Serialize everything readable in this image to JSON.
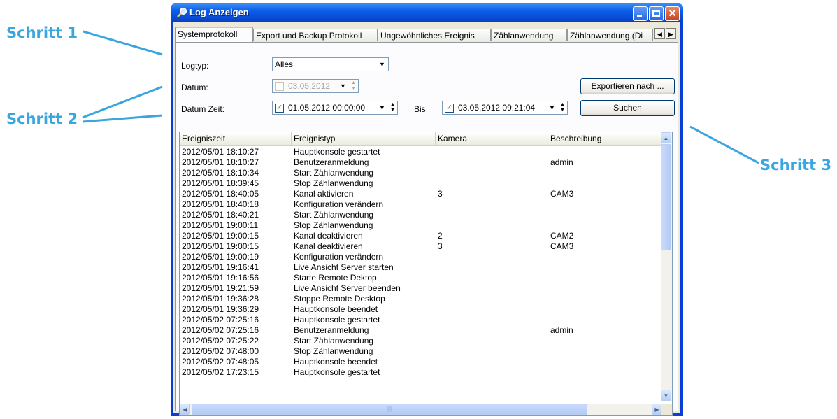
{
  "annotations": {
    "step1": "Schritt 1",
    "step2": "Schritt 2",
    "step3": "Schritt 3",
    "color": "#3aa6e0"
  },
  "window": {
    "title": "Log Anzeigen",
    "icon": "magnifier-icon",
    "close_glyph": "✕"
  },
  "tabs": [
    {
      "label": "Systemprotokoll",
      "active": true
    },
    {
      "label": "Export und Backup Protokoll",
      "active": false
    },
    {
      "label": "Ungewöhnliches Ereignis",
      "active": false
    },
    {
      "label": "Zählanwendung",
      "active": false
    },
    {
      "label": "Zählanwendung (Di",
      "active": false
    }
  ],
  "tab_scroll": {
    "left": "◀",
    "right": "▶"
  },
  "form": {
    "logtyp_label": "Logtyp:",
    "logtyp_value": "Alles",
    "datum_label": "Datum:",
    "datum_value": "03.05.2012",
    "datumzeit_label": "Datum Zeit:",
    "from_value": "01.05.2012 00:00:00",
    "bis_label": "Bis",
    "to_value": "03.05.2012 09:21:04",
    "export_button": "Exportieren nach ...",
    "search_button": "Suchen",
    "check_glyph": "✓",
    "dropdown_glyph": "▼",
    "spin_up": "▲",
    "spin_down": "▼"
  },
  "table": {
    "columns": [
      "Ereigniszeit",
      "Ereignistyp",
      "Kamera",
      "Beschreibung"
    ],
    "rows": [
      [
        "2012/05/01 18:10:27",
        "Hauptkonsole gestartet",
        "",
        ""
      ],
      [
        "2012/05/01 18:10:27",
        "Benutzeranmeldung",
        "",
        "admin"
      ],
      [
        "2012/05/01 18:10:34",
        "Start Zählanwendung",
        "",
        ""
      ],
      [
        "2012/05/01 18:39:45",
        "Stop Zählanwendung",
        "",
        ""
      ],
      [
        "2012/05/01 18:40:05",
        "Kanal aktivieren",
        "3",
        "CAM3"
      ],
      [
        "2012/05/01 18:40:18",
        "Konfiguration verändern",
        "",
        ""
      ],
      [
        "2012/05/01 18:40:21",
        "Start Zählanwendung",
        "",
        ""
      ],
      [
        "2012/05/01 19:00:11",
        "Stop Zählanwendung",
        "",
        ""
      ],
      [
        "2012/05/01 19:00:15",
        "Kanal deaktivieren",
        "2",
        "CAM2"
      ],
      [
        "2012/05/01 19:00:15",
        "Kanal deaktivieren",
        "3",
        "CAM3"
      ],
      [
        "2012/05/01 19:00:19",
        "Konfiguration verändern",
        "",
        ""
      ],
      [
        "2012/05/01 19:16:41",
        "Live Ansicht Server starten",
        "",
        ""
      ],
      [
        "2012/05/01 19:16:56",
        "Starte Remote Dektop",
        "",
        ""
      ],
      [
        "2012/05/01 19:21:59",
        "Live Ansicht Server beenden",
        "",
        ""
      ],
      [
        "2012/05/01 19:36:28",
        "Stoppe Remote Desktop",
        "",
        ""
      ],
      [
        "2012/05/01 19:36:29",
        "Hauptkonsole beendet",
        "",
        ""
      ],
      [
        "2012/05/02 07:25:16",
        "Hauptkonsole gestartet",
        "",
        ""
      ],
      [
        "2012/05/02 07:25:16",
        "Benutzeranmeldung",
        "",
        "admin"
      ],
      [
        "2012/05/02 07:25:22",
        "Start Zählanwendung",
        "",
        ""
      ],
      [
        "2012/05/02 07:48:00",
        "Stop Zählanwendung",
        "",
        ""
      ],
      [
        "2012/05/02 07:48:05",
        "Hauptkonsole beendet",
        "",
        ""
      ],
      [
        "2012/05/02 17:23:15",
        "Hauptkonsole gestartet",
        "",
        ""
      ]
    ]
  },
  "scrollbar": {
    "up": "▲",
    "down": "▼",
    "left": "◀",
    "right": "▶",
    "grip": "|||"
  }
}
